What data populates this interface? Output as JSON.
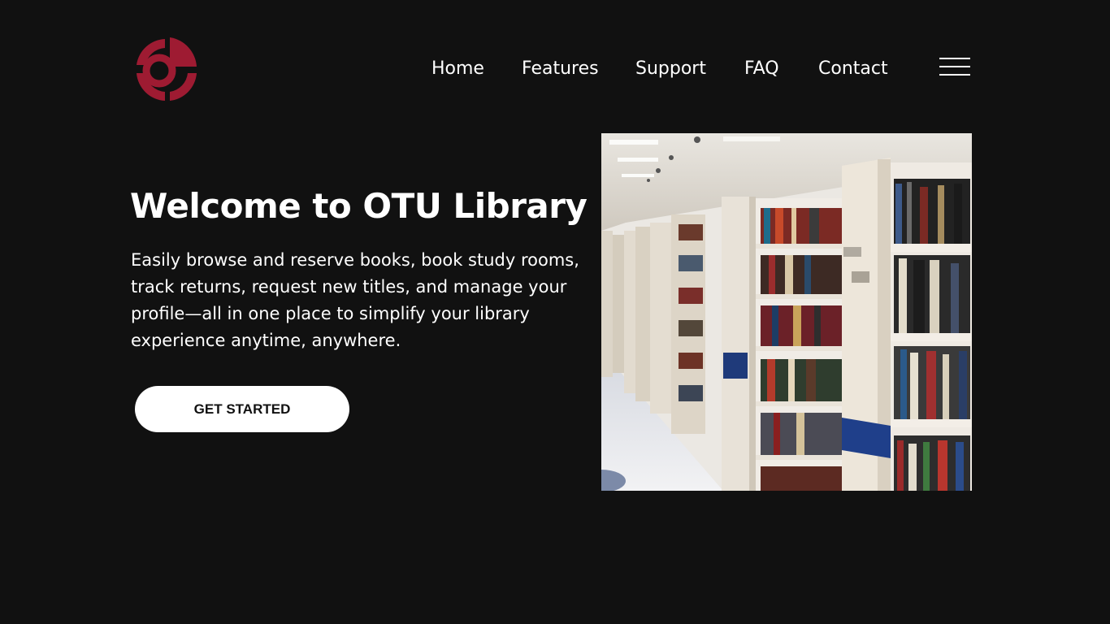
{
  "nav": {
    "items": [
      "Home",
      "Features",
      "Support",
      "FAQ",
      "Contact"
    ]
  },
  "icons": {
    "logo": "target-logo",
    "menu": "hamburger-menu-icon"
  },
  "hero": {
    "title": "Welcome to OTU Library",
    "description": "Easily browse and reserve books, book study rooms, track returns, request new titles, and manage your profile—all in one place to simplify your library experience anytime, anywhere.",
    "cta_label": "GET STARTED",
    "image": "library-bookshelves-photo"
  },
  "colors": {
    "background": "#111111",
    "brand": "#9e1b32",
    "text": "#ffffff",
    "button_bg": "#ffffff",
    "button_text": "#111111"
  }
}
